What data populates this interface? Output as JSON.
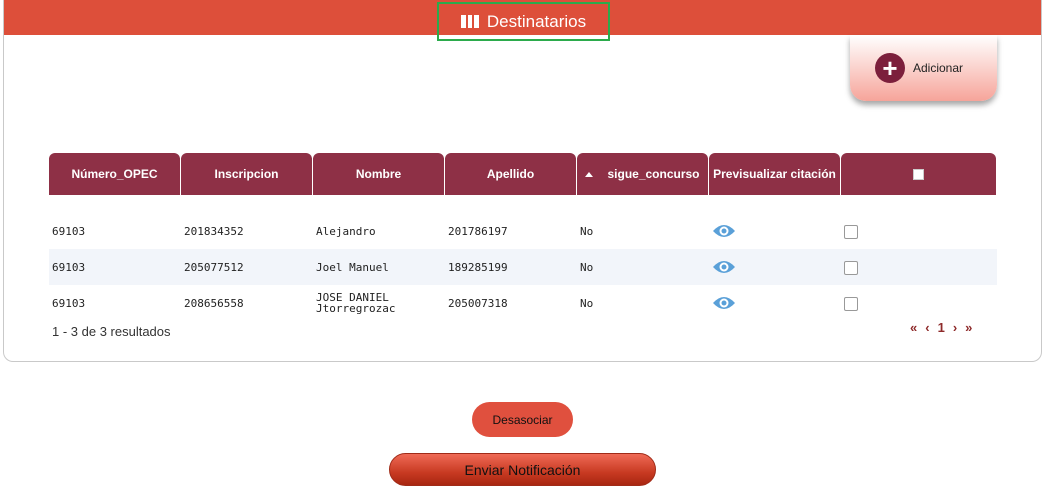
{
  "header": {
    "title": "Destinatarios",
    "icon": "book-icon"
  },
  "add_button": {
    "label": "Adicionar",
    "icon": "plus-circle-icon"
  },
  "table": {
    "columns": [
      "Número_OPEC",
      "Inscripcion",
      "Nombre",
      "Apellido",
      "sigue_concurso",
      "Previsualizar citación",
      ""
    ],
    "rows": [
      {
        "opec": "69103",
        "inscripcion": "201834352",
        "nombre": "Alejandro",
        "nombre2": "",
        "apellido": "201786197",
        "sigue": "No"
      },
      {
        "opec": "69103",
        "inscripcion": "205077512",
        "nombre": "Joel Manuel",
        "nombre2": "",
        "apellido": "189285199",
        "sigue": "No"
      },
      {
        "opec": "69103",
        "inscripcion": "208656558",
        "nombre": "JOSE DANIEL",
        "nombre2": "Jtorregrozac",
        "apellido": "205007318",
        "sigue": "No"
      }
    ]
  },
  "pagination": {
    "summary": "1 - 3 de 3 resultados",
    "first": "«",
    "prev": "‹",
    "page": "1",
    "next": "›",
    "last": "»"
  },
  "actions": {
    "desasociar": "Desasociar",
    "enviar": "Enviar Notificación"
  },
  "colors": {
    "header": "#dd4f3a",
    "table_header": "#8e3046",
    "eye": "#5aa0d8"
  }
}
